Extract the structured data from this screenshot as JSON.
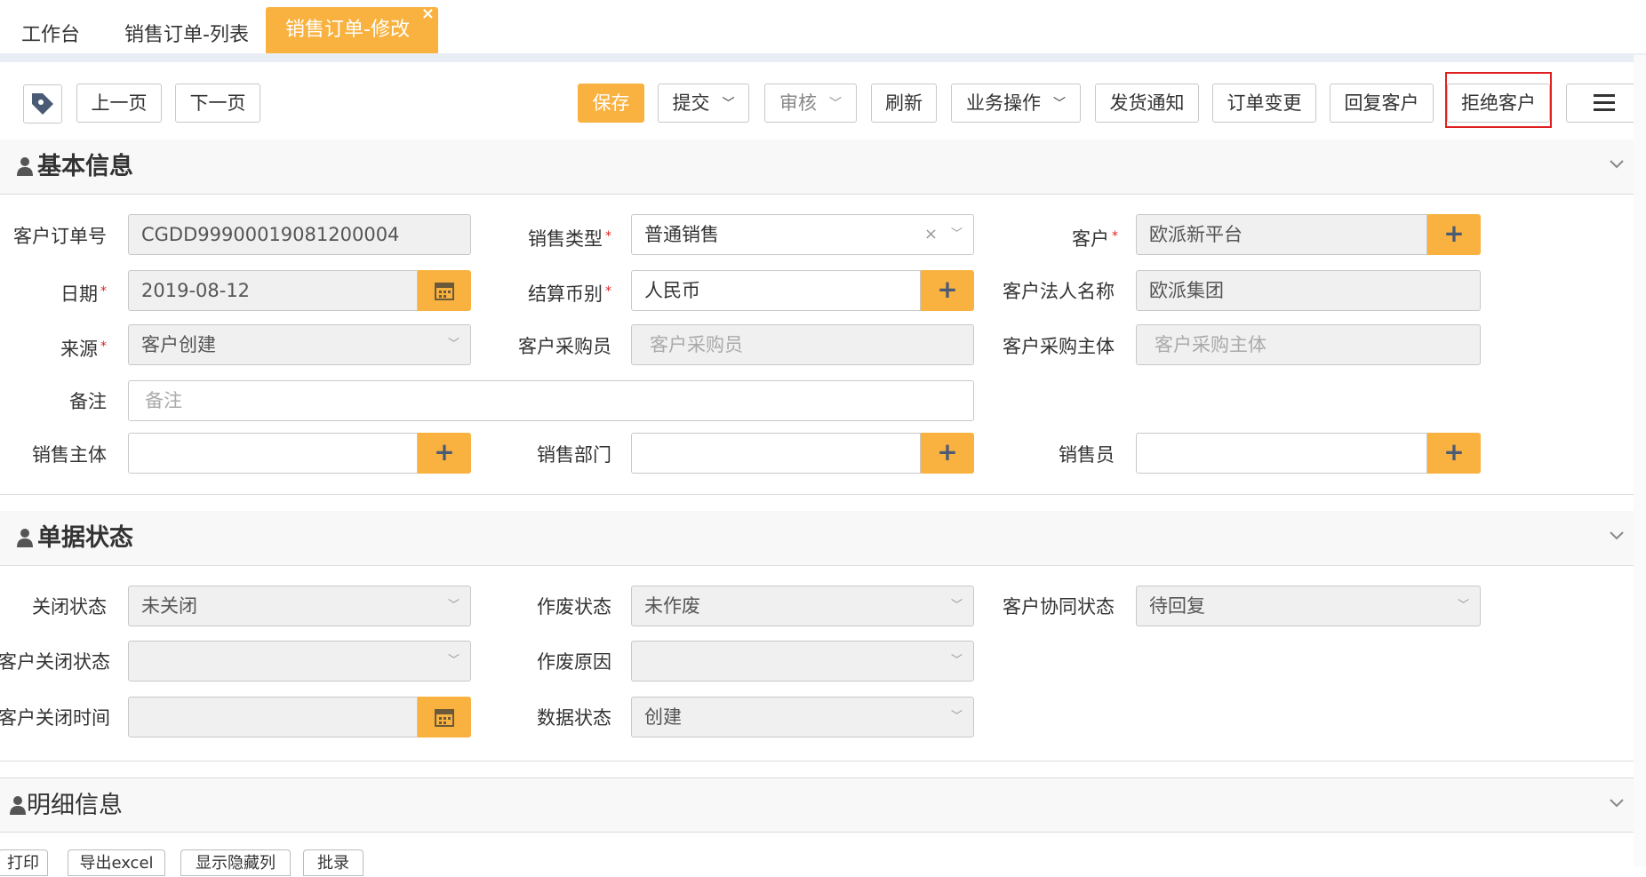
{
  "tabs": {
    "items": [
      {
        "label": "工作台"
      },
      {
        "label": "销售订单-列表"
      },
      {
        "label": "销售订单-修改"
      }
    ],
    "close": "×"
  },
  "toolbar": {
    "prev": "上一页",
    "next": "下一页",
    "save": "保存",
    "submit": "提交",
    "audit": "审核",
    "refresh": "刷新",
    "business": "业务操作",
    "ship_notice": "发货通知",
    "order_change": "订单变更",
    "reply_customer": "回复客户",
    "reject_customer": "拒绝客户"
  },
  "basic": {
    "title": "基本信息",
    "customer_order_no_label": "客户订单号",
    "customer_order_no": "CGDD99900019081200004",
    "sales_type_label": "销售类型",
    "sales_type": "普通销售",
    "customer_label": "客户",
    "customer": "欧派新平台",
    "date_label": "日期",
    "date": "2019-08-12",
    "currency_label": "结算币别",
    "currency": "人民币",
    "legal_name_label": "客户法人名称",
    "legal_name": "欧派集团",
    "source_label": "来源",
    "source": "客户创建",
    "buyer_label": "客户采购员",
    "buyer_placeholder": "客户采购员",
    "buyer_entity_label": "客户采购主体",
    "buyer_entity_placeholder": "客户采购主体",
    "remark_label": "备注",
    "remark_placeholder": "备注",
    "sales_entity_label": "销售主体",
    "sales_dept_label": "销售部门",
    "salesman_label": "销售员"
  },
  "status": {
    "title": "单据状态",
    "close_status_label": "关闭状态",
    "close_status": "未关闭",
    "void_status_label": "作废状态",
    "void_status": "未作废",
    "collab_status_label": "客户协同状态",
    "collab_status": "待回复",
    "customer_close_label": "客户关闭状态",
    "void_reason_label": "作废原因",
    "customer_close_time_label": "客户关闭时间",
    "data_status_label": "数据状态",
    "data_status": "创建"
  },
  "detail": {
    "title": "明细信息",
    "print": "打印",
    "export": "导出excel",
    "toggle_cols": "显示隐藏列",
    "batch": "批录"
  },
  "colors": {
    "accent": "#f9b240",
    "required": "#e02020",
    "highlight": "#e02020"
  }
}
